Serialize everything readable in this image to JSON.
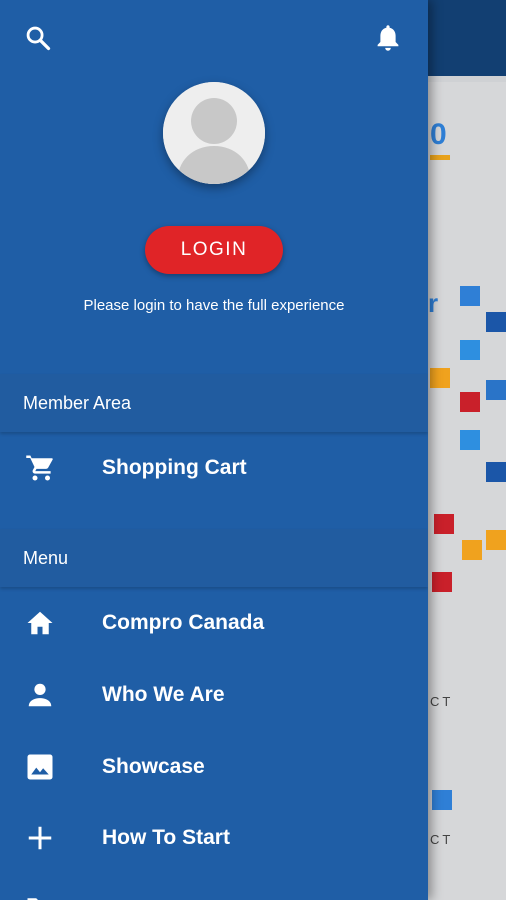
{
  "drawer": {
    "top_icons": {
      "search": "search-icon",
      "notifications": "bell-icon"
    },
    "login_button": "LOGIN",
    "login_note": "Please login to have the full experience"
  },
  "sections": {
    "member_area": {
      "title": "Member Area",
      "items": [
        {
          "label": "Shopping Cart",
          "icon": "shopping-cart-icon"
        }
      ]
    },
    "menu": {
      "title": "Menu",
      "items": [
        {
          "label": "Compro Canada",
          "icon": "home-icon"
        },
        {
          "label": "Who We Are",
          "icon": "person-icon"
        },
        {
          "label": "Showcase",
          "icon": "image-icon"
        },
        {
          "label": "How To Start",
          "icon": "plus-icon"
        }
      ]
    }
  },
  "background": {
    "logo_text": "0",
    "fragment_1": "r",
    "fragment_2": "CT",
    "fragment_3": "CT"
  },
  "colors": {
    "drawer_bg": "#1f5ea6",
    "login_button": "#e02427",
    "text": "#ffffff"
  }
}
